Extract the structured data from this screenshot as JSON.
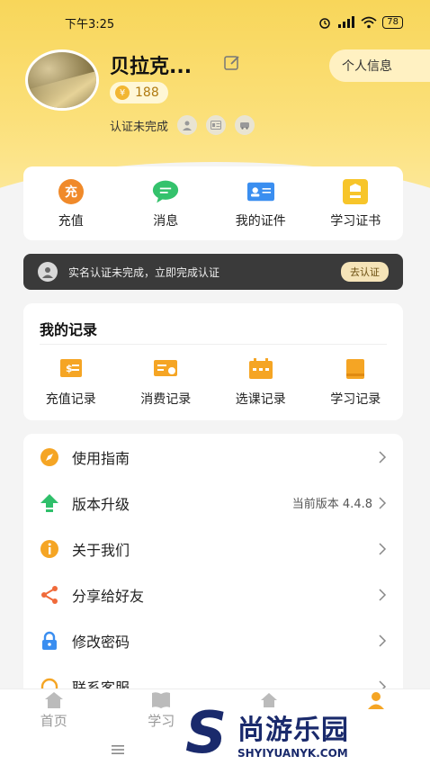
{
  "status_bar": {
    "time": "下午3:25",
    "battery": "78"
  },
  "profile": {
    "username": "贝拉克...",
    "coins": "188",
    "personal_info_button": "个人信息",
    "cert_status": "认证未完成"
  },
  "quick_actions": [
    {
      "label": "充值",
      "icon": "recharge-icon"
    },
    {
      "label": "消息",
      "icon": "message-icon"
    },
    {
      "label": "我的证件",
      "icon": "id-card-icon"
    },
    {
      "label": "学习证书",
      "icon": "certificate-icon"
    }
  ],
  "quick_icon_text": {
    "recharge": "充"
  },
  "banner": {
    "text": "实名认证未完成，立即完成认证",
    "button": "去认证"
  },
  "records": {
    "title": "我的记录",
    "items": [
      {
        "label": "充值记录",
        "icon": "recharge-record-icon"
      },
      {
        "label": "消费记录",
        "icon": "consumption-record-icon"
      },
      {
        "label": "选课记录",
        "icon": "course-selection-record-icon"
      },
      {
        "label": "学习记录",
        "icon": "study-record-icon"
      }
    ]
  },
  "menu": [
    {
      "label": "使用指南",
      "icon": "compass-icon",
      "extra": ""
    },
    {
      "label": "版本升级",
      "icon": "upgrade-arrow-icon",
      "extra": "当前版本 4.4.8"
    },
    {
      "label": "关于我们",
      "icon": "info-icon",
      "extra": ""
    },
    {
      "label": "分享给好友",
      "icon": "share-icon",
      "extra": ""
    },
    {
      "label": "修改密码",
      "icon": "lock-icon",
      "extra": ""
    },
    {
      "label": "联系客服",
      "icon": "headset-icon",
      "extra": ""
    }
  ],
  "tabs": [
    {
      "label": "首页",
      "icon": "home-icon"
    },
    {
      "label": "学习",
      "icon": "book-icon"
    },
    {
      "label": "",
      "icon": "house-icon"
    },
    {
      "label": "",
      "icon": "user-icon"
    }
  ],
  "watermark": {
    "letter": "S",
    "cn": "尚游乐园",
    "en": "SHYIYUANYK.COM"
  },
  "colors": {
    "accent": "#f8d65a",
    "banner_bg": "#3a3a3a",
    "orange": "#f5a524",
    "green": "#2fbf6a",
    "blue": "#3a8ef0",
    "brand_watermark": "#1a2a6c"
  }
}
